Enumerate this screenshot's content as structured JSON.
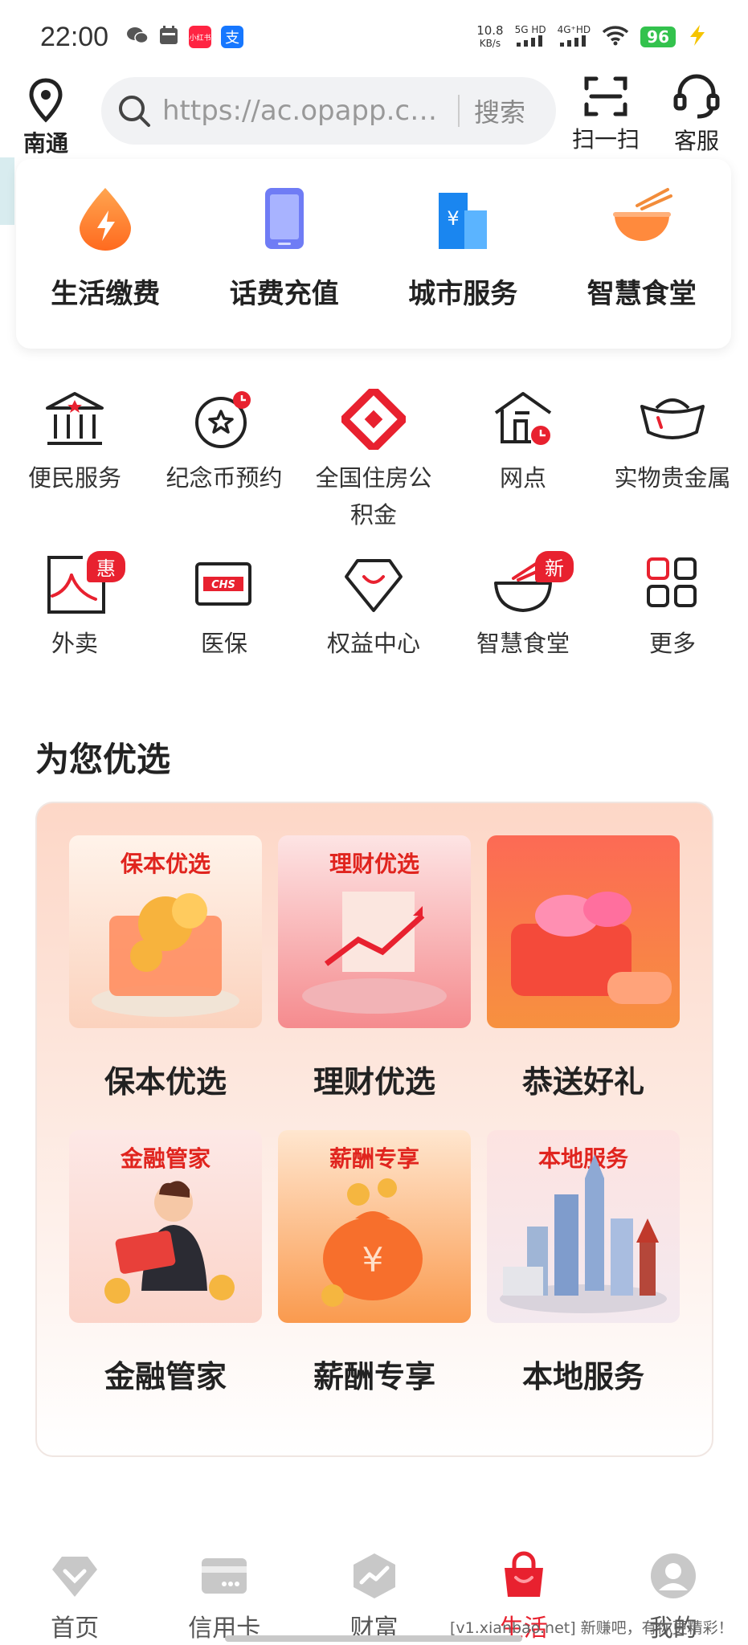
{
  "status": {
    "time": "22:00",
    "net_speed_value": "10.8",
    "net_speed_unit": "KB/s",
    "sig1": "5G HD",
    "sig2": "4G⁺HD",
    "battery": "96",
    "app_badge_1": "小红书",
    "app_badge_2": "支"
  },
  "header": {
    "location": "南通",
    "search_text": "https://ac.opapp.cn/...",
    "search_button": "搜索",
    "scan_label": "扫一扫",
    "service_label": "客服"
  },
  "top_services": [
    {
      "label": "生活缴费",
      "icon": "lightning-drop-icon"
    },
    {
      "label": "话费充值",
      "icon": "phone-icon"
    },
    {
      "label": "城市服务",
      "icon": "city-building-icon"
    },
    {
      "label": "智慧食堂",
      "icon": "noodle-bowl-icon"
    }
  ],
  "grid_row1": [
    {
      "label": "便民服务",
      "icon": "bank-building-icon"
    },
    {
      "label": "纪念币预约",
      "icon": "coin-star-icon"
    },
    {
      "label": "全国住房公积金",
      "icon": "housing-fund-icon"
    },
    {
      "label": "网点",
      "icon": "branch-icon"
    },
    {
      "label": "实物贵金属",
      "icon": "gold-ingot-icon"
    }
  ],
  "grid_row2": [
    {
      "label": "外卖",
      "icon": "takeout-icon",
      "badge": "惠"
    },
    {
      "label": "医保",
      "icon": "chs-card-icon"
    },
    {
      "label": "权益中心",
      "icon": "diamond-icon"
    },
    {
      "label": "智慧食堂",
      "icon": "bowl-icon",
      "badge": "新"
    },
    {
      "label": "更多",
      "icon": "grid-more-icon"
    }
  ],
  "section_title": "为您优选",
  "promos": [
    {
      "tag": "保本优选",
      "label": "保本优选"
    },
    {
      "tag": "理财优选",
      "label": "理财优选"
    },
    {
      "tag": "",
      "label": "恭送好礼"
    },
    {
      "tag": "金融管家",
      "label": "金融管家"
    },
    {
      "tag": "薪酬专享",
      "label": "薪酬专享"
    },
    {
      "tag": "本地服务",
      "label": "本地服务"
    }
  ],
  "nav": [
    {
      "label": "首页",
      "icon": "home-diamond-icon"
    },
    {
      "label": "信用卡",
      "icon": "credit-card-icon"
    },
    {
      "label": "财富",
      "icon": "wealth-chart-icon"
    },
    {
      "label": "生活",
      "icon": "shopping-bag-icon"
    },
    {
      "label": "我的",
      "icon": "user-profile-icon"
    }
  ],
  "watermark": "[v1.xianbao.net] 新赚吧，有你更精彩！",
  "colors": {
    "accent": "#e8212f",
    "orange": "#ff8a3d",
    "blue": "#2e8fee"
  }
}
